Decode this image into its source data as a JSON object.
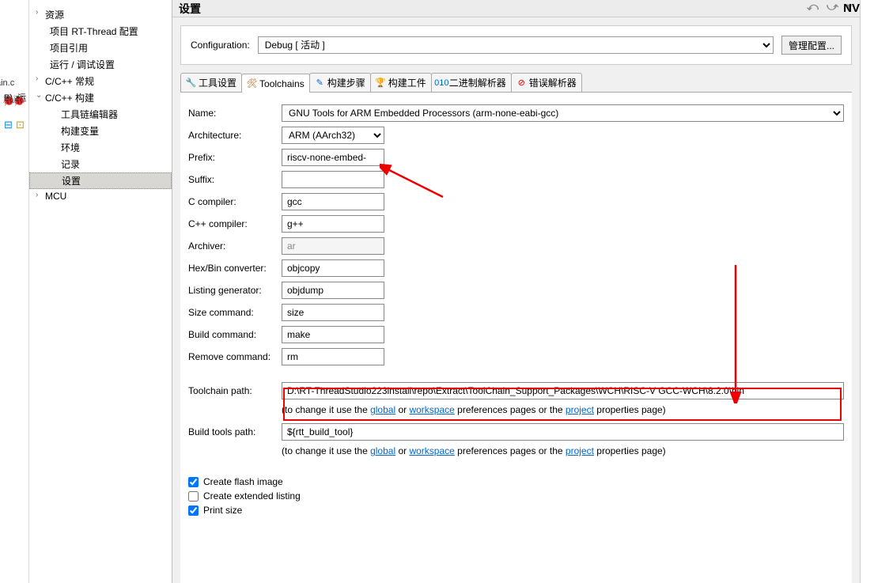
{
  "header": {
    "title": "设置"
  },
  "tree": {
    "items": [
      {
        "label": "资源",
        "arrow": "›",
        "lvl": 0
      },
      {
        "label": "项目 RT-Thread 配置",
        "lvl": 1
      },
      {
        "label": "项目引用",
        "lvl": 1
      },
      {
        "label": "运行 / 调试设置",
        "lvl": 1
      },
      {
        "label": "C/C++ 常规",
        "arrow": "›",
        "lvl": 0
      },
      {
        "label": "C/C++ 构建",
        "arrow": "⌄",
        "lvl": 0
      },
      {
        "label": "工具链编辑器",
        "lvl": 2
      },
      {
        "label": "构建变量",
        "lvl": 2
      },
      {
        "label": "环境",
        "lvl": 2
      },
      {
        "label": "记录",
        "lvl": 2
      },
      {
        "label": "设置",
        "lvl": 2,
        "selected": true
      },
      {
        "label": "MCU",
        "arrow": "›",
        "lvl": 0
      }
    ]
  },
  "config": {
    "label": "Configuration:",
    "value": "Debug  [ 活动 ]",
    "manage_btn": "管理配置..."
  },
  "tabs": [
    {
      "label": "工具设置",
      "icon": "🔧",
      "color": "#0aa"
    },
    {
      "label": "Toolchains",
      "icon": "🛠",
      "active": true,
      "color": "#a50"
    },
    {
      "label": "构建步骤",
      "icon": "✎",
      "color": "#06c"
    },
    {
      "label": "构建工件",
      "icon": "🏆",
      "color": "#cc8800"
    },
    {
      "label": "二进制解析器",
      "icon": "010",
      "color": "#06c"
    },
    {
      "label": "错误解析器",
      "icon": "⊘",
      "color": "#d00"
    }
  ],
  "fields": {
    "name": {
      "label": "Name:",
      "value": "GNU Tools for ARM Embedded Processors (arm-none-eabi-gcc)"
    },
    "arch": {
      "label": "Architecture:",
      "value": "ARM (AArch32)"
    },
    "prefix": {
      "label": "Prefix:",
      "value": "riscv-none-embed-"
    },
    "suffix": {
      "label": "Suffix:",
      "value": ""
    },
    "ccompiler": {
      "label": "C compiler:",
      "value": "gcc"
    },
    "cppcompiler": {
      "label": "C++ compiler:",
      "value": "g++"
    },
    "archiver": {
      "label": "Archiver:",
      "value": "ar"
    },
    "hexbin": {
      "label": "Hex/Bin converter:",
      "value": "objcopy"
    },
    "listing": {
      "label": "Listing generator:",
      "value": "objdump"
    },
    "size": {
      "label": "Size command:",
      "value": "size"
    },
    "build": {
      "label": "Build command:",
      "value": "make"
    },
    "remove": {
      "label": "Remove command:",
      "value": "rm"
    },
    "toolchainpath": {
      "label": "Toolchain path:",
      "value": "D:\\RT-ThreadStudio223install\\repo\\Extract\\ToolChain_Support_Packages\\WCH\\RISC-V GCC-WCH\\8.2.0\\bin"
    },
    "buildtoolspath": {
      "label": "Build tools path:",
      "value": "${rtt_build_tool}"
    }
  },
  "hint": {
    "pre": "(to change it use the ",
    "global": "global",
    "or": " or ",
    "workspace": "workspace",
    "mid": " preferences pages or the ",
    "project": "project",
    "post": " properties page)"
  },
  "checkboxes": {
    "flash": {
      "label": "Create flash image",
      "checked": true
    },
    "listing": {
      "label": "Create extended listing",
      "checked": false
    },
    "printsize": {
      "label": "Print size",
      "checked": true
    }
  },
  "leftstrip": {
    "filetab": "ain.c",
    "p": "P)",
    "run": "运"
  },
  "nv": "NV"
}
